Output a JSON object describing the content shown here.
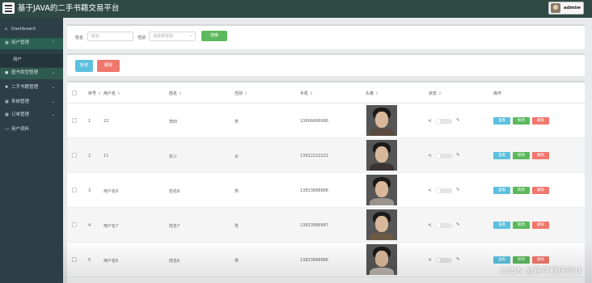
{
  "app": {
    "title": "基于JAVA的二手书籍交易平台",
    "user": "admin"
  },
  "sidebar": {
    "items": [
      {
        "label": "Dashboard",
        "icon": "home-icon"
      },
      {
        "label": "用户管理",
        "icon": "grid-icon",
        "expanded": true
      },
      {
        "label": "用户",
        "sub": true
      },
      {
        "label": "图书类型管理",
        "icon": "user-icon"
      },
      {
        "label": "二手书籍管理",
        "icon": "gear-icon"
      },
      {
        "label": "系统管理",
        "icon": "grid-icon"
      },
      {
        "label": "订单管理",
        "icon": "grid-icon"
      },
      {
        "label": "用户资料",
        "icon": "calendar-icon"
      }
    ]
  },
  "search": {
    "name_label": "姓名",
    "name_placeholder": "姓名",
    "gender_label": "性别",
    "gender_placeholder": "请选择性别",
    "search_button": "搜索"
  },
  "actions": {
    "add": "新增",
    "delete": "删除"
  },
  "table": {
    "columns": [
      "序号",
      "用户名",
      "姓名",
      "性别",
      "手机",
      "头像",
      "状态",
      "操作"
    ],
    "row_actions": {
      "view": "查看",
      "edit": "修改",
      "delete": "删除"
    },
    "rows": [
      {
        "index": "1",
        "username": "22",
        "name": "李四",
        "gender": "男",
        "phone": "13666666666",
        "avatar_tone": "#5b4a3d"
      },
      {
        "index": "2",
        "username": "11",
        "name": "张三",
        "gender": "女",
        "phone": "13922222222",
        "avatar_tone": "#3a3330"
      },
      {
        "index": "3",
        "username": "用户名8",
        "name": "姓名8",
        "gender": "男",
        "phone": "13823888888",
        "avatar_tone": "#9a948c"
      },
      {
        "index": "4",
        "username": "用户名7",
        "name": "姓名7",
        "gender": "男",
        "phone": "13823888887",
        "avatar_tone": "#6e5a44"
      },
      {
        "index": "5",
        "username": "用户名6",
        "name": "姓名6",
        "gender": "男",
        "phone": "13823888886",
        "avatar_tone": "#b8b2aa"
      }
    ]
  },
  "watermark": "CSDN @路可程序设计",
  "colors": {
    "topbar": "#2f4a45",
    "sidebar": "#2c3e46",
    "view": "#5bc0de",
    "edit": "#5cb85c",
    "delete": "#f0776c"
  }
}
